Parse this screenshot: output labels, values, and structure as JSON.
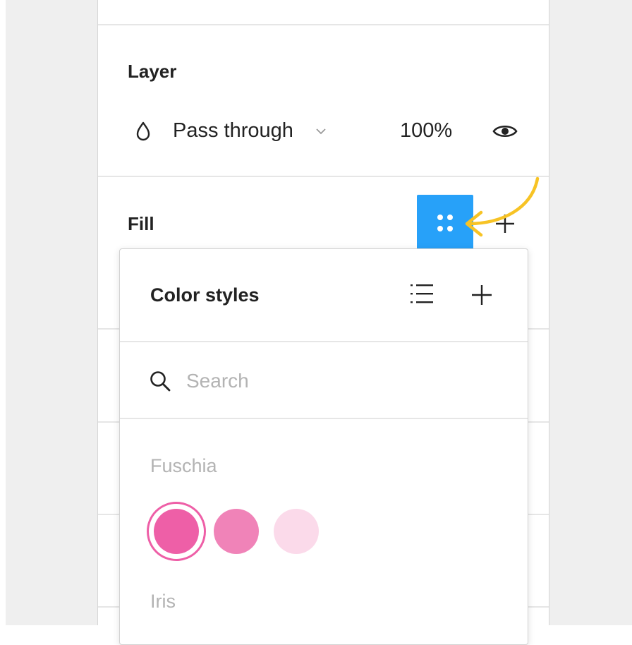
{
  "layer": {
    "title": "Layer",
    "blend_mode": "Pass through",
    "opacity": "100%",
    "icons": {
      "blend": "droplet-icon",
      "dropdown": "chevron-down-icon",
      "visibility": "eye-icon"
    }
  },
  "fill": {
    "title": "Fill",
    "icons": {
      "styles": "style-grid-icon",
      "add": "plus-icon",
      "annotation": "arrow-annotation"
    }
  },
  "color_styles": {
    "title": "Color styles",
    "icons": {
      "list_view": "list-view-icon",
      "add": "plus-icon",
      "search": "search-icon"
    },
    "search": {
      "placeholder": "Search",
      "value": ""
    },
    "groups": [
      {
        "name": "Fuschia",
        "swatches": [
          "#ee5fa7",
          "#f083b8",
          "#fbdaea"
        ],
        "selected_index": 0
      },
      {
        "name": "Iris",
        "swatches": []
      }
    ]
  },
  "colors": {
    "accent": "#27a1f9",
    "annotation": "#f7c325",
    "selection_ring": "#ee5fa7"
  }
}
